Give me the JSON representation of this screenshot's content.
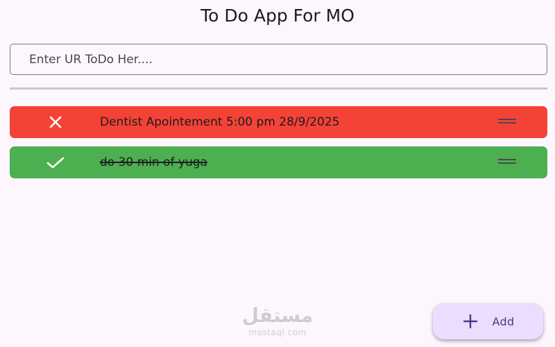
{
  "header": {
    "title": "To Do App For MO"
  },
  "input": {
    "placeholder": "Enter UR ToDo Her....",
    "value": ""
  },
  "todos": [
    {
      "text": "Dentist Apointement 5:00 pm 28/9/2025",
      "done": false,
      "status_icon": "close-icon",
      "color": "#f44336"
    },
    {
      "text": "do 30 min of yuga",
      "done": true,
      "status_icon": "check-icon",
      "color": "#4caf50"
    }
  ],
  "fab": {
    "label": "Add",
    "icon": "plus-icon",
    "color": "#eaddff"
  },
  "watermark": {
    "arabic": "مستقل",
    "latin": "mostaql.com"
  },
  "colors": {
    "background": "#fdf7fd",
    "pending": "#f44336",
    "done": "#4caf50",
    "accent": "#4f378b"
  }
}
